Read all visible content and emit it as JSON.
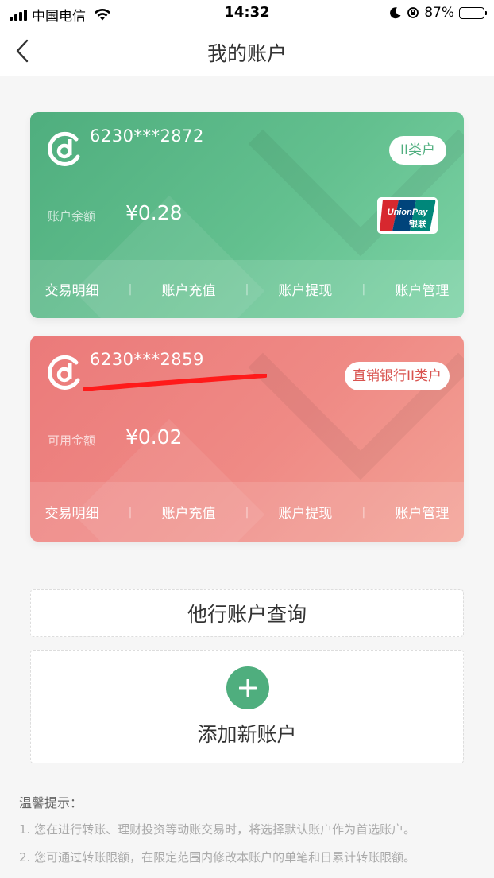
{
  "status_bar": {
    "carrier": "中国电信",
    "time": "14:32",
    "battery": "87%",
    "battery_level": 0.87
  },
  "nav": {
    "title": "我的账户"
  },
  "cards": [
    {
      "number": "6230***2872",
      "badge": "II类户",
      "balance_label": "账户余额",
      "balance": "¥0.28",
      "actions": [
        "交易明细",
        "账户充值",
        "账户提现",
        "账户管理"
      ],
      "color": "#4fae7e",
      "unionpay": {
        "en": "UnionPay",
        "cn": "银联"
      }
    },
    {
      "number": "6230***2859",
      "badge": "直销银行II类户",
      "balance_label": "可用金额",
      "balance": "¥0.02",
      "actions": [
        "交易明细",
        "账户充值",
        "账户提现",
        "账户管理"
      ],
      "color": "#eb7a7a"
    }
  ],
  "action_separator": "|",
  "query": {
    "label": "他行账户查询"
  },
  "add": {
    "label": "添加新账户"
  },
  "tips": {
    "title": "温馨提示：",
    "items": [
      "1. 您在进行转账、理财投资等动账交易时，将选择默认账户作为首选账户。",
      "2. 您可通过转账限额，在限定范围内修改本账户的单笔和日累计转账限额。"
    ]
  }
}
